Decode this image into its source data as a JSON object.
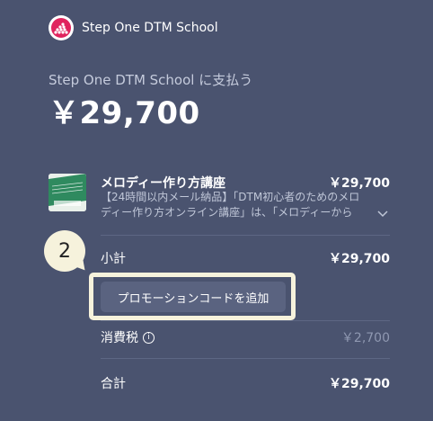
{
  "merchant": {
    "name": "Step One DTM School",
    "pay_to": "Step One DTM School に支払う",
    "total": "￥29,700"
  },
  "item": {
    "name": "メロディー作り方講座",
    "price": "￥29,700",
    "description": "【24時間以内メール納品】「DTM初心者のためのメロディー作り方オンライン講座」は、「メロディーから作..."
  },
  "summary": {
    "subtotal_label": "小計",
    "subtotal_value": "￥29,700",
    "promo_label": "プロモーションコードを追加",
    "tax_label": "消費税",
    "tax_value": "￥2,700",
    "total_label": "合計",
    "total_value": "￥29,700"
  },
  "callout": {
    "number": "2"
  },
  "colors": {
    "background": "#4a536f",
    "callout": "#f6f2dc",
    "logo_accent": "#e0245e"
  },
  "icons": {
    "logo": "brand-logo-icon",
    "chevron": "chevron-down-icon",
    "info": "info-icon"
  }
}
